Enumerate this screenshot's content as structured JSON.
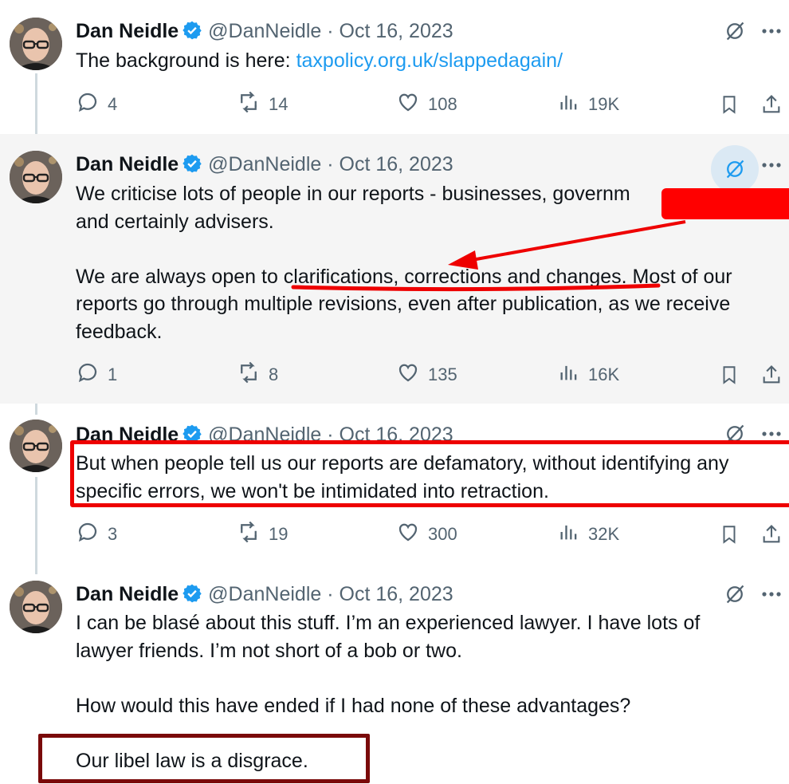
{
  "tweets": [
    {
      "author": {
        "name": "Dan Neidle",
        "handle": "@DanNeidle",
        "date": "Oct 16, 2023",
        "sep": "·"
      },
      "text_before_link": "The background is here: ",
      "link": "taxpolicy.org.uk/slappedagain/",
      "metrics": {
        "replies": "4",
        "reposts": "14",
        "likes": "108",
        "views": "19K"
      }
    },
    {
      "author": {
        "name": "Dan Neidle",
        "handle": "@DanNeidle",
        "date": "Oct 16, 2023",
        "sep": "·"
      },
      "para1_line1": "We criticise lots of people in our reports - businesses, governm",
      "para1_line2": "and certainly advisers.",
      "para2_lead": "We are always open to ",
      "para2_underlined": "clarifications, corrections and changes.",
      "para2_rest": " Most of our",
      "para2_line2": "reports go through multiple revisions, even after publication, as we receive",
      "para2_line3": "feedback.",
      "metrics": {
        "replies": "1",
        "reposts": "8",
        "likes": "135",
        "views": "16K"
      }
    },
    {
      "author": {
        "name": "Dan Neidle",
        "handle": "@DanNeidle",
        "date": "Oct 16, 2023",
        "sep": "·"
      },
      "line1": "But when people tell us our reports are defamatory, without identifying any",
      "line2": "specific errors, we won't be intimidated into retraction.",
      "metrics": {
        "replies": "3",
        "reposts": "19",
        "likes": "300",
        "views": "32K"
      }
    },
    {
      "author": {
        "name": "Dan Neidle",
        "handle": "@DanNeidle",
        "date": "Oct 16, 2023",
        "sep": "·"
      },
      "line1": "I can be blasé about this stuff. I’m an experienced lawyer. I have lots of",
      "line2": "lawyer friends. I’m not short of a bob or two.",
      "line3": "How would this have ended if I had none of these advantages?",
      "line4": "Our libel law is a disgrace."
    }
  ],
  "colors": {
    "accent": "#1d9bf0",
    "muted": "#536471",
    "annotation_red": "#ee0000",
    "annotation_dark_red": "#7a0a0a",
    "highlight_bg": "#f5f5f5"
  },
  "icons": [
    "verified-badge-icon",
    "grok-icon",
    "more-icon",
    "reply-icon",
    "repost-icon",
    "like-icon",
    "views-icon",
    "bookmark-icon",
    "share-icon"
  ]
}
